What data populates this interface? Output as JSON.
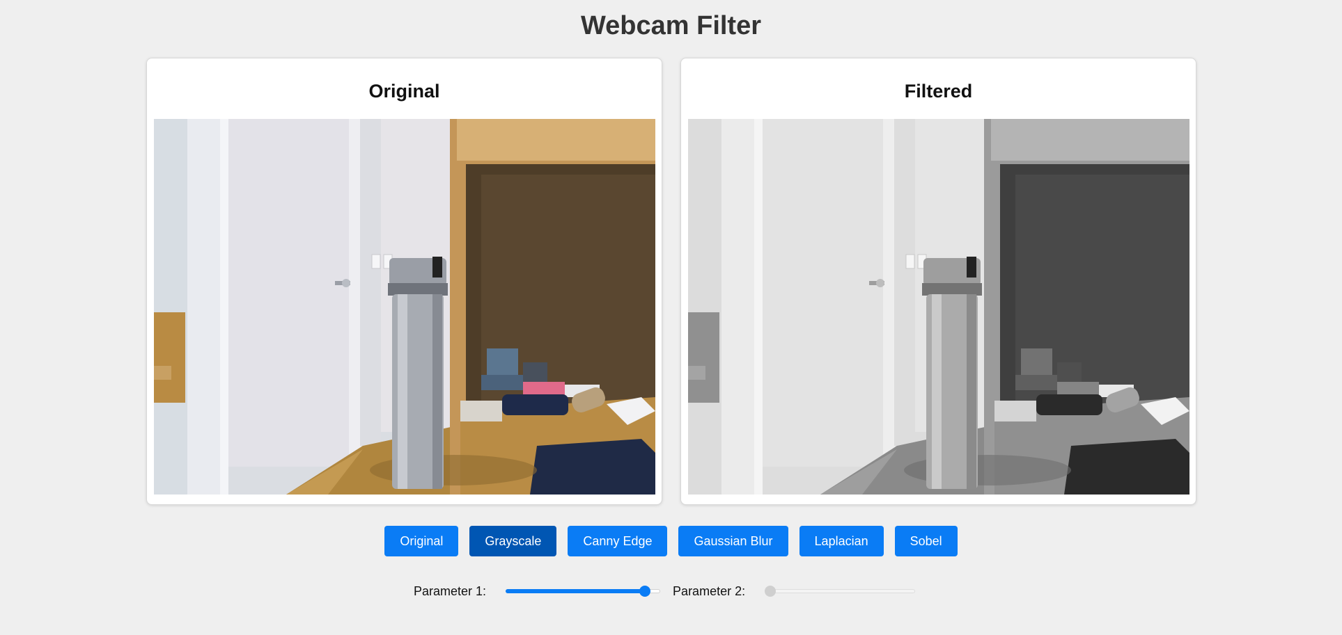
{
  "header": {
    "title": "Webcam Filter"
  },
  "panels": {
    "original": {
      "title": "Original"
    },
    "filtered": {
      "title": "Filtered"
    }
  },
  "filters": {
    "buttons": [
      {
        "label": "Original",
        "active": false
      },
      {
        "label": "Grayscale",
        "active": true
      },
      {
        "label": "Canny Edge",
        "active": false
      },
      {
        "label": "Gaussian Blur",
        "active": false
      },
      {
        "label": "Laplacian",
        "active": false
      },
      {
        "label": "Sobel",
        "active": false
      }
    ]
  },
  "controls": {
    "param1": {
      "label": "Parameter 1:",
      "value_fraction": 0.9,
      "enabled": true
    },
    "param2": {
      "label": "Parameter 2:",
      "value_fraction": 0.0,
      "enabled": false
    }
  },
  "colors": {
    "accent": "#0a7cf5",
    "accent_active": "#0056b3",
    "background": "#efefef"
  }
}
